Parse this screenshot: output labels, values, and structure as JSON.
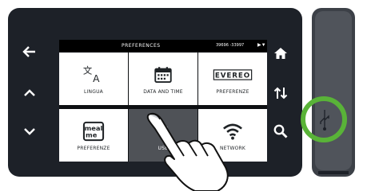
{
  "screen": {
    "title": "PREFERENCES",
    "status_info": "39696 -33997"
  },
  "tiles": [
    {
      "label": "LINGUA",
      "icon": "translate-icon"
    },
    {
      "label": "DATA AND TIME",
      "icon": "calendar-icon"
    },
    {
      "label": "PREFERENZE",
      "icon": "evereo-logo-icon",
      "logo_text": "EVEREO"
    },
    {
      "label": "PREFERENZE",
      "icon": "meal-me-icon",
      "logo_text": "meal me"
    },
    {
      "label": "USB",
      "icon": "usb-icon",
      "selected": true
    },
    {
      "label": "NETWORK",
      "icon": "wifi-icon"
    }
  ],
  "colors": {
    "device_body": "#1d2128",
    "selected_tile": "#4f5257",
    "highlight_ring": "#59b338"
  }
}
